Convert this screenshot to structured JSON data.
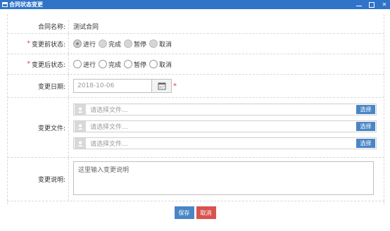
{
  "window": {
    "title": "合同状态变更"
  },
  "form": {
    "contract_name": {
      "label": "合同名称:",
      "value": "测试合同"
    },
    "before_status": {
      "label": "变更前状态:",
      "options": [
        "进行",
        "完成",
        "暂停",
        "取消"
      ],
      "selected": "进行"
    },
    "after_status": {
      "label": "变更后状态:",
      "options": [
        "进行",
        "完成",
        "暂停",
        "取消"
      ],
      "selected": ""
    },
    "change_date": {
      "label": "变更日期:",
      "value": "2018-10-06"
    },
    "change_files": {
      "label": "变更文件:",
      "placeholder": "请选择文件...",
      "button": "选择"
    },
    "description": {
      "label": "变更说明:",
      "placeholder": "这里输入变更说明"
    }
  },
  "footer": {
    "save_label": "保存",
    "cancel_label": "取消"
  }
}
